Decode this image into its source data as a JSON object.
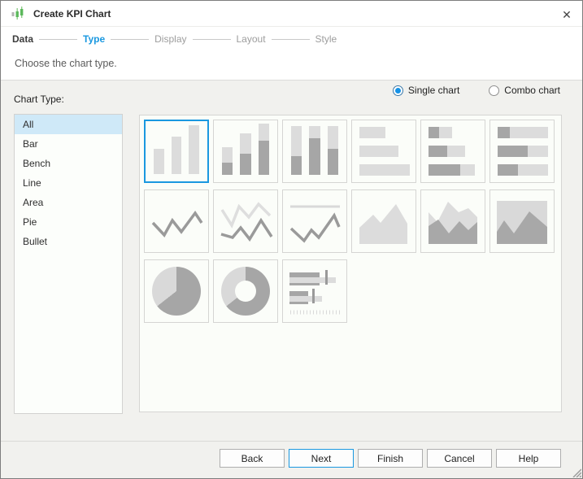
{
  "window": {
    "title": "Create KPI Chart",
    "close_glyph": "✕"
  },
  "steps": {
    "items": [
      {
        "label": "Data",
        "state": "done"
      },
      {
        "label": "Type",
        "state": "active"
      },
      {
        "label": "Display",
        "state": "future"
      },
      {
        "label": "Layout",
        "state": "future"
      },
      {
        "label": "Style",
        "state": "future"
      }
    ]
  },
  "subtitle": "Choose the chart type.",
  "mode": {
    "options": [
      {
        "label": "Single chart",
        "selected": true
      },
      {
        "label": "Combo chart",
        "selected": false
      }
    ]
  },
  "sidebar": {
    "label": "Chart Type:",
    "items": [
      {
        "label": "All",
        "selected": true
      },
      {
        "label": "Bar",
        "selected": false
      },
      {
        "label": "Bench",
        "selected": false
      },
      {
        "label": "Line",
        "selected": false
      },
      {
        "label": "Area",
        "selected": false
      },
      {
        "label": "Pie",
        "selected": false
      },
      {
        "label": "Bullet",
        "selected": false
      }
    ]
  },
  "gallery": {
    "items": [
      {
        "name": "bar",
        "selected": true
      },
      {
        "name": "stacked-bar",
        "selected": false
      },
      {
        "name": "bench-bar",
        "selected": false
      },
      {
        "name": "horizontal-bar",
        "selected": false
      },
      {
        "name": "horizontal-stacked-bar",
        "selected": false
      },
      {
        "name": "horizontal-bench-bar",
        "selected": false
      },
      {
        "name": "line",
        "selected": false
      },
      {
        "name": "multi-line",
        "selected": false
      },
      {
        "name": "bench-line",
        "selected": false
      },
      {
        "name": "area",
        "selected": false
      },
      {
        "name": "stacked-area",
        "selected": false
      },
      {
        "name": "bench-area",
        "selected": false
      },
      {
        "name": "pie",
        "selected": false
      },
      {
        "name": "donut",
        "selected": false
      },
      {
        "name": "bullet",
        "selected": false
      }
    ]
  },
  "footer": {
    "buttons": [
      {
        "label": "Back",
        "default": false
      },
      {
        "label": "Next",
        "default": true
      },
      {
        "label": "Finish",
        "default": false
      },
      {
        "label": "Cancel",
        "default": false
      },
      {
        "label": "Help",
        "default": false
      }
    ]
  },
  "colors": {
    "accent": "#1a98e0",
    "selection_fill": "#cfe9f8",
    "thumb_light": "#dcdcdc",
    "thumb_dark": "#a6a6a6",
    "content_bg": "#f1f1ee",
    "panel_bg": "#fbfdf9"
  }
}
